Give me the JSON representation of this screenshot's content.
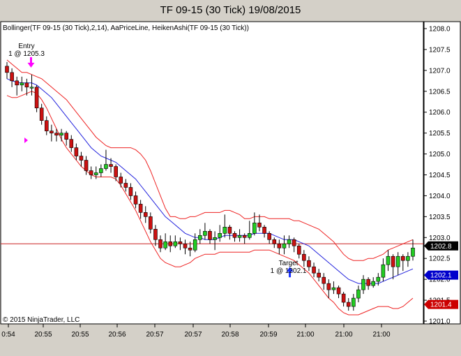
{
  "window": {
    "title": "TF 09-15 (30 Tick)  19/08/2015"
  },
  "indicators_label": "Bollinger(TF 09-15 (30 Tick),2,14), AaPriceLine, HeikenAshi(TF 09-15 (30 Tick))",
  "copyright": "© 2015 NinjaTrader, LLC",
  "colors": {
    "background": "#ffffff",
    "window_bg": "#d4d0c8",
    "up_candle": "#22cc22",
    "down_candle": "#cc1111",
    "bollinger_outer": "#ee2222",
    "bollinger_mid": "#2222dd",
    "price_line": "#cc2222",
    "entry_arrow": "#ff00ff",
    "target_arrow": "#1a33ff",
    "tag_current": "#000000",
    "tag_blue": "#0000cc",
    "tag_red": "#cc0000"
  },
  "annotations": {
    "entry": {
      "title": "Entry",
      "detail": "1 @ 1205.3",
      "price": 1206.9
    },
    "target": {
      "title": "Target",
      "detail": "1 @ 1202.1",
      "price": 1202.3
    }
  },
  "price_tags": [
    {
      "label": "1202.8",
      "value": 1202.8,
      "style": "current"
    },
    {
      "label": "1202.1",
      "value": 1202.1,
      "style": "blue"
    },
    {
      "label": "1201.4",
      "value": 1201.4,
      "style": "red"
    }
  ],
  "chart_data": {
    "type": "candlestick",
    "ylim": [
      1200.95,
      1208.15
    ],
    "y_ticks": [
      "1201.0",
      "1201.5",
      "1202.0",
      "1202.5",
      "1203.0",
      "1203.5",
      "1204.0",
      "1204.5",
      "1205.0",
      "1205.5",
      "1206.0",
      "1206.5",
      "1207.0",
      "1207.5",
      "1208.0"
    ],
    "x_tick_labels": [
      "0:54",
      "20:55",
      "20:55",
      "20:56",
      "20:57",
      "20:57",
      "20:58",
      "20:59",
      "21:00",
      "21:00",
      "21:00"
    ],
    "horizontal_line": 1202.85,
    "candles": [
      [
        1207.1,
        1206.95,
        1207.2,
        1206.8
      ],
      [
        1206.95,
        1206.75,
        1207.05,
        1206.6
      ],
      [
        1206.75,
        1206.65,
        1206.85,
        1206.4
      ],
      [
        1206.65,
        1206.7,
        1206.85,
        1206.5
      ],
      [
        1206.7,
        1206.6,
        1206.8,
        1206.4
      ],
      [
        1206.6,
        1206.6,
        1206.9,
        1206.4
      ],
      [
        1206.6,
        1206.1,
        1206.65,
        1206.0
      ],
      [
        1206.1,
        1205.8,
        1206.2,
        1205.7
      ],
      [
        1205.8,
        1205.55,
        1205.9,
        1205.45
      ],
      [
        1205.55,
        1205.5,
        1205.7,
        1205.3
      ],
      [
        1205.5,
        1205.45,
        1205.6,
        1205.3
      ],
      [
        1205.45,
        1205.5,
        1205.6,
        1205.3
      ],
      [
        1205.5,
        1205.35,
        1205.55,
        1205.2
      ],
      [
        1205.35,
        1205.15,
        1205.45,
        1205.05
      ],
      [
        1205.15,
        1204.95,
        1205.25,
        1204.85
      ],
      [
        1204.95,
        1204.85,
        1205.05,
        1204.7
      ],
      [
        1204.85,
        1204.6,
        1204.95,
        1204.5
      ],
      [
        1204.6,
        1204.5,
        1204.7,
        1204.4
      ],
      [
        1204.5,
        1204.55,
        1204.7,
        1204.4
      ],
      [
        1204.55,
        1204.65,
        1204.75,
        1204.45
      ],
      [
        1204.65,
        1204.75,
        1205.1,
        1204.6
      ],
      [
        1204.75,
        1204.7,
        1204.9,
        1204.55
      ],
      [
        1204.7,
        1204.45,
        1204.75,
        1204.35
      ],
      [
        1204.45,
        1204.3,
        1204.55,
        1204.2
      ],
      [
        1204.3,
        1204.2,
        1204.4,
        1204.1
      ],
      [
        1204.2,
        1204.0,
        1204.3,
        1203.9
      ],
      [
        1204.0,
        1203.8,
        1204.1,
        1203.7
      ],
      [
        1203.8,
        1203.6,
        1203.9,
        1203.45
      ],
      [
        1203.6,
        1203.5,
        1203.75,
        1203.35
      ],
      [
        1203.5,
        1203.2,
        1203.6,
        1203.1
      ],
      [
        1203.2,
        1202.95,
        1203.3,
        1202.8
      ],
      [
        1202.95,
        1202.75,
        1203.05,
        1202.65
      ],
      [
        1202.75,
        1202.9,
        1203.1,
        1202.7
      ],
      [
        1202.9,
        1202.8,
        1203.05,
        1202.65
      ],
      [
        1202.8,
        1202.9,
        1203.05,
        1202.75
      ],
      [
        1202.9,
        1202.85,
        1203.0,
        1202.7
      ],
      [
        1202.85,
        1202.75,
        1202.95,
        1202.6
      ],
      [
        1202.75,
        1202.7,
        1202.9,
        1202.55
      ],
      [
        1202.7,
        1202.95,
        1203.1,
        1202.65
      ],
      [
        1202.95,
        1203.05,
        1203.2,
        1202.85
      ],
      [
        1203.05,
        1203.15,
        1203.35,
        1202.95
      ],
      [
        1203.15,
        1202.95,
        1203.2,
        1202.85
      ],
      [
        1202.95,
        1203.0,
        1203.15,
        1202.7
      ],
      [
        1203.0,
        1203.1,
        1203.3,
        1202.9
      ],
      [
        1203.1,
        1203.25,
        1203.55,
        1203.0
      ],
      [
        1203.25,
        1203.1,
        1203.3,
        1202.95
      ],
      [
        1203.1,
        1203.0,
        1203.15,
        1202.9
      ],
      [
        1203.0,
        1203.05,
        1203.2,
        1202.9
      ],
      [
        1203.05,
        1203.0,
        1203.1,
        1202.85
      ],
      [
        1203.0,
        1203.1,
        1203.4,
        1202.95
      ],
      [
        1203.1,
        1203.35,
        1203.6,
        1203.05
      ],
      [
        1203.35,
        1203.25,
        1203.55,
        1203.15
      ],
      [
        1203.25,
        1203.1,
        1203.3,
        1203.0
      ],
      [
        1203.1,
        1202.95,
        1203.15,
        1202.85
      ],
      [
        1202.95,
        1202.85,
        1203.0,
        1202.75
      ],
      [
        1202.85,
        1202.75,
        1202.95,
        1202.6
      ],
      [
        1202.75,
        1202.85,
        1203.05,
        1202.6
      ],
      [
        1202.85,
        1202.95,
        1203.05,
        1202.75
      ],
      [
        1202.95,
        1202.8,
        1203.0,
        1202.65
      ],
      [
        1202.8,
        1202.6,
        1202.85,
        1202.5
      ],
      [
        1202.6,
        1202.45,
        1202.7,
        1202.3
      ],
      [
        1202.45,
        1202.3,
        1202.55,
        1202.2
      ],
      [
        1202.3,
        1202.15,
        1202.4,
        1202.05
      ],
      [
        1202.15,
        1202.05,
        1202.25,
        1201.95
      ],
      [
        1202.05,
        1201.9,
        1202.15,
        1201.75
      ],
      [
        1201.9,
        1201.75,
        1202.0,
        1201.55
      ],
      [
        1201.75,
        1201.8,
        1201.95,
        1201.65
      ],
      [
        1201.8,
        1201.65,
        1201.85,
        1201.55
      ],
      [
        1201.65,
        1201.45,
        1201.7,
        1201.35
      ],
      [
        1201.45,
        1201.35,
        1201.55,
        1201.25
      ],
      [
        1201.35,
        1201.55,
        1201.65,
        1201.25
      ],
      [
        1201.55,
        1201.75,
        1201.85,
        1201.45
      ],
      [
        1201.75,
        1202.0,
        1202.1,
        1201.65
      ],
      [
        1202.0,
        1201.85,
        1202.05,
        1201.75
      ],
      [
        1201.85,
        1201.95,
        1202.05,
        1201.8
      ],
      [
        1201.95,
        1202.05,
        1202.15,
        1201.85
      ],
      [
        1202.05,
        1202.35,
        1202.5,
        1201.95
      ],
      [
        1202.35,
        1202.55,
        1202.7,
        1202.2
      ],
      [
        1202.55,
        1202.3,
        1202.6,
        1202.0
      ],
      [
        1202.3,
        1202.55,
        1202.65,
        1202.1
      ],
      [
        1202.55,
        1202.45,
        1202.6,
        1202.2
      ],
      [
        1202.45,
        1202.55,
        1202.65,
        1202.3
      ],
      [
        1202.55,
        1202.75,
        1202.95,
        1202.45
      ]
    ],
    "upper_band": [
      1207.25,
      1207.15,
      1207.05,
      1206.95,
      1206.95,
      1206.9,
      1206.85,
      1206.8,
      1206.7,
      1206.6,
      1206.5,
      1206.4,
      1206.3,
      1206.15,
      1206.0,
      1205.85,
      1205.7,
      1205.55,
      1205.4,
      1205.3,
      1205.2,
      1205.15,
      1205.15,
      1205.15,
      1205.15,
      1205.15,
      1205.1,
      1205.0,
      1204.85,
      1204.6,
      1204.3,
      1204.0,
      1203.7,
      1203.5,
      1203.5,
      1203.45,
      1203.45,
      1203.5,
      1203.5,
      1203.55,
      1203.6,
      1203.6,
      1203.6,
      1203.6,
      1203.65,
      1203.65,
      1203.6,
      1203.55,
      1203.45,
      1203.45,
      1203.5,
      1203.5,
      1203.5,
      1203.45,
      1203.45,
      1203.45,
      1203.45,
      1203.45,
      1203.4,
      1203.4,
      1203.35,
      1203.3,
      1203.25,
      1203.2,
      1203.1,
      1203.0,
      1202.9,
      1202.75,
      1202.6,
      1202.5,
      1202.45,
      1202.45,
      1202.45,
      1202.5,
      1202.5,
      1202.55,
      1202.6,
      1202.7,
      1202.75,
      1202.8,
      1202.85,
      1202.9,
      1202.95
    ],
    "middle_band": [
      1206.8,
      1206.75,
      1206.72,
      1206.7,
      1206.7,
      1206.7,
      1206.65,
      1206.55,
      1206.45,
      1206.35,
      1206.2,
      1206.05,
      1205.9,
      1205.75,
      1205.6,
      1205.45,
      1205.3,
      1205.15,
      1205.05,
      1204.95,
      1204.9,
      1204.85,
      1204.8,
      1204.7,
      1204.6,
      1204.5,
      1204.4,
      1204.25,
      1204.1,
      1203.95,
      1203.8,
      1203.65,
      1203.5,
      1203.4,
      1203.3,
      1203.2,
      1203.1,
      1203.05,
      1203.0,
      1203.0,
      1202.95,
      1202.95,
      1202.95,
      1203.0,
      1203.05,
      1203.05,
      1203.05,
      1203.05,
      1203.05,
      1203.05,
      1203.1,
      1203.1,
      1203.1,
      1203.1,
      1203.05,
      1203.0,
      1202.95,
      1202.95,
      1202.95,
      1202.9,
      1202.85,
      1202.8,
      1202.7,
      1202.6,
      1202.5,
      1202.4,
      1202.3,
      1202.2,
      1202.1,
      1202.0,
      1201.95,
      1201.9,
      1201.9,
      1201.9,
      1201.9,
      1201.9,
      1201.95,
      1202.0,
      1202.05,
      1202.1,
      1202.15,
      1202.2,
      1202.25
    ],
    "lower_band": [
      1206.4,
      1206.35,
      1206.35,
      1206.4,
      1206.45,
      1206.5,
      1206.45,
      1206.3,
      1206.1,
      1205.85,
      1205.6,
      1205.35,
      1205.15,
      1205.0,
      1204.85,
      1204.7,
      1204.6,
      1204.5,
      1204.45,
      1204.45,
      1204.45,
      1204.45,
      1204.4,
      1204.25,
      1204.05,
      1203.85,
      1203.65,
      1203.4,
      1203.15,
      1202.9,
      1202.7,
      1202.5,
      1202.4,
      1202.35,
      1202.3,
      1202.3,
      1202.35,
      1202.4,
      1202.5,
      1202.55,
      1202.6,
      1202.6,
      1202.6,
      1202.65,
      1202.65,
      1202.65,
      1202.65,
      1202.65,
      1202.65,
      1202.65,
      1202.7,
      1202.7,
      1202.7,
      1202.7,
      1202.65,
      1202.6,
      1202.55,
      1202.5,
      1202.45,
      1202.35,
      1202.25,
      1202.15,
      1202.0,
      1201.85,
      1201.7,
      1201.55,
      1201.45,
      1201.3,
      1201.2,
      1201.15,
      1201.15,
      1201.15,
      1201.2,
      1201.25,
      1201.3,
      1201.35,
      1201.35,
      1201.35,
      1201.3,
      1201.3,
      1201.35,
      1201.45,
      1201.55
    ]
  }
}
